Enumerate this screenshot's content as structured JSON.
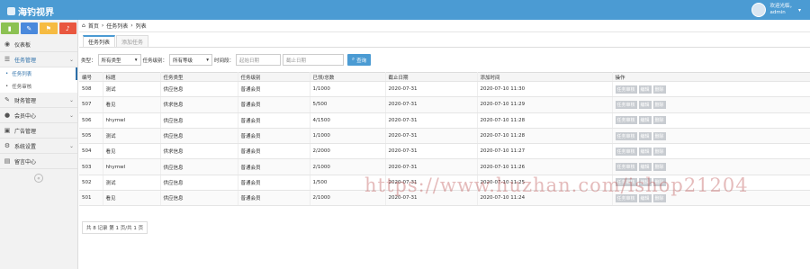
{
  "header": {
    "brand": "海钓视界",
    "user_greeting": "欢迎光临，",
    "user_name": "admin"
  },
  "colors": {
    "topbar": "#4b9bd3",
    "shortcut_green": "#8cc152",
    "shortcut_blue": "#4a89dc",
    "shortcut_orange": "#f6bb42",
    "shortcut_red": "#e9573f"
  },
  "sidebar": {
    "shortcuts": [
      {
        "icon": "signal-icon"
      },
      {
        "icon": "pencil-icon"
      },
      {
        "icon": "group-icon"
      },
      {
        "icon": "bell-icon"
      }
    ],
    "menu": [
      {
        "label": "仪表板",
        "icon": "dashboard-icon"
      },
      {
        "label": "任务管理",
        "icon": "list-icon",
        "expanded": true,
        "children": [
          {
            "label": "任务列表",
            "active": true
          },
          {
            "label": "任务审核",
            "active": false
          }
        ]
      },
      {
        "label": "财务管理",
        "icon": "pencil-icon"
      },
      {
        "label": "会员中心",
        "icon": "user-icon"
      },
      {
        "label": "广告管理",
        "icon": "image-icon"
      },
      {
        "label": "系统设置",
        "icon": "gear-icon"
      },
      {
        "label": "留言中心",
        "icon": "note-icon"
      }
    ]
  },
  "breadcrumb": {
    "home": "首页",
    "section": "任务列表",
    "current": "列表"
  },
  "tabs": [
    {
      "label": "任务列表",
      "active": true
    },
    {
      "label": "添加任务",
      "active": false
    }
  ],
  "filters": {
    "type_label": "类型：",
    "type_value": "所有类型",
    "level_label": "任务级别：",
    "level_value": "所有等级",
    "time_label": "时间段：",
    "start_placeholder": "起始日期",
    "end_placeholder": "截止日期",
    "search_label": "查询"
  },
  "table": {
    "columns": [
      "编号",
      "标题",
      "任务类型",
      "任务级别",
      "已领/总数",
      "截止日期",
      "添加时间",
      "操作"
    ],
    "rows": [
      {
        "id": "508",
        "title": "测试",
        "type": "供应信息",
        "level": "普通会员",
        "count": "1/1000",
        "deadline": "2020-07-31",
        "added": "2020-07-10 11:30",
        "actions": [
          "任务审核",
          "编辑",
          "删除"
        ]
      },
      {
        "id": "507",
        "title": "看见",
        "type": "供求信息",
        "level": "普通会员",
        "count": "5/500",
        "deadline": "2020-07-31",
        "added": "2020-07-10 11:29",
        "actions": [
          "任务审核",
          "编辑",
          "删除"
        ]
      },
      {
        "id": "506",
        "title": "hhymwl",
        "type": "供应信息",
        "level": "普通会员",
        "count": "4/1500",
        "deadline": "2020-07-31",
        "added": "2020-07-10 11:28",
        "actions": [
          "任务审核",
          "编辑",
          "删除"
        ]
      },
      {
        "id": "505",
        "title": "测试",
        "type": "供应信息",
        "level": "普通会员",
        "count": "1/1000",
        "deadline": "2020-07-31",
        "added": "2020-07-10 11:28",
        "actions": [
          "任务审核",
          "编辑",
          "删除"
        ]
      },
      {
        "id": "504",
        "title": "看见",
        "type": "供求信息",
        "level": "普通会员",
        "count": "2/2000",
        "deadline": "2020-07-31",
        "added": "2020-07-10 11:27",
        "actions": [
          "任务审核",
          "编辑",
          "删除"
        ]
      },
      {
        "id": "503",
        "title": "hhymwl",
        "type": "供应信息",
        "level": "普通会员",
        "count": "2/1000",
        "deadline": "2020-07-31",
        "added": "2020-07-10 11:26",
        "actions": [
          "任务审核",
          "编辑",
          "删除"
        ]
      },
      {
        "id": "502",
        "title": "测试",
        "type": "供应信息",
        "level": "普通会员",
        "count": "1/500",
        "deadline": "2020-07-31",
        "added": "2020-07-10 11:25",
        "actions": [
          "任务审核",
          "编辑",
          "删除"
        ]
      },
      {
        "id": "501",
        "title": "看见",
        "type": "供应信息",
        "level": "普通会员",
        "count": "2/1000",
        "deadline": "2020-07-31",
        "added": "2020-07-10 11:24",
        "actions": [
          "任务审核",
          "编辑",
          "删除"
        ]
      }
    ]
  },
  "pager": {
    "text": "共 8 记录 第 1 页/共 1 页"
  },
  "watermark": "https://www.huzhan.com/ishop21204"
}
